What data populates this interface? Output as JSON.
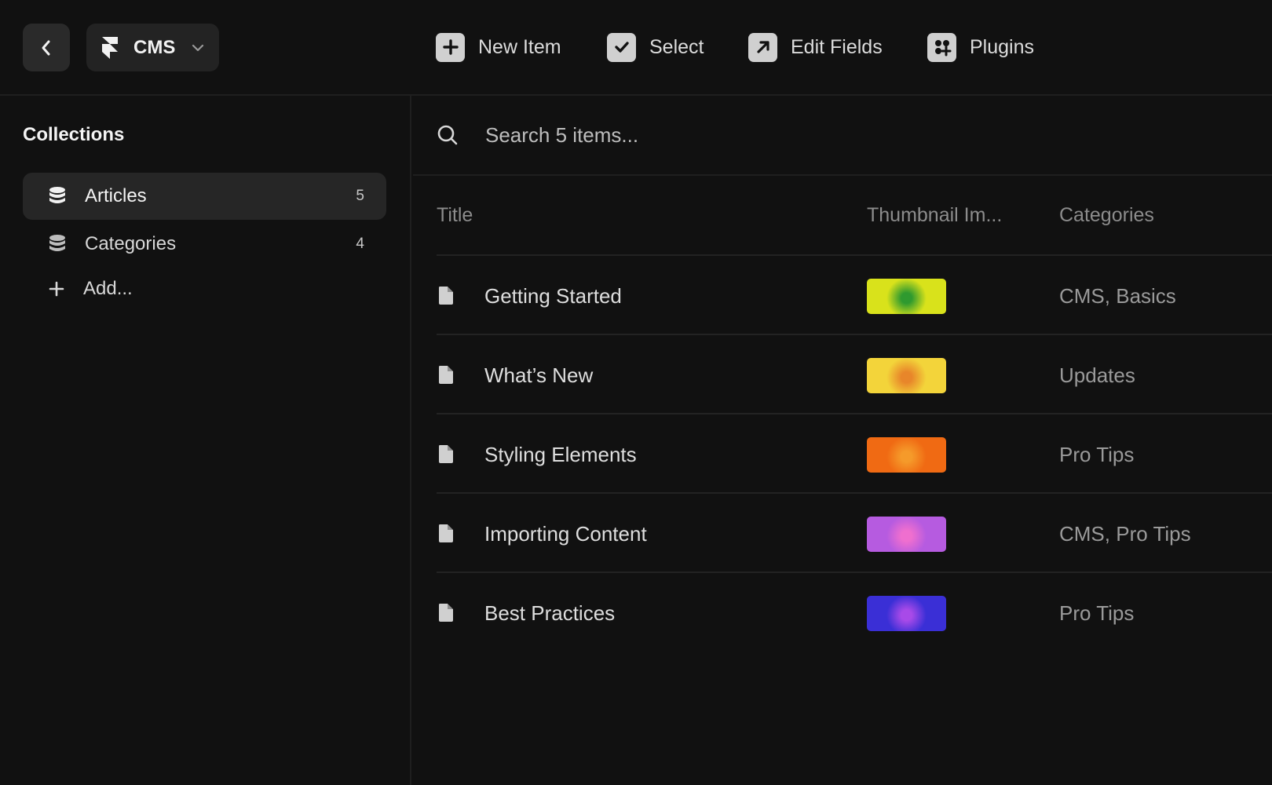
{
  "toolbar": {
    "back_icon": "chevron-left-icon",
    "cms_label": "CMS",
    "new_item": "New Item",
    "select": "Select",
    "edit_fields": "Edit Fields",
    "plugins": "Plugins"
  },
  "sidebar": {
    "title": "Collections",
    "items": [
      {
        "label": "Articles",
        "count": "5",
        "icon": "database-icon",
        "active": true
      },
      {
        "label": "Categories",
        "count": "4",
        "icon": "database-icon",
        "active": false
      }
    ],
    "add_label": "Add..."
  },
  "search": {
    "placeholder": "Search 5 items..."
  },
  "table": {
    "headers": {
      "title": "Title",
      "thumbnail": "Thumbnail Im...",
      "categories": "Categories"
    },
    "rows": [
      {
        "title": "Getting Started",
        "categories": "CMS, Basics",
        "thumb_colors": [
          "#d9e21b",
          "#2f9a2f"
        ]
      },
      {
        "title": "What’s New",
        "categories": "Updates",
        "thumb_colors": [
          "#f3d43a",
          "#e8862a"
        ]
      },
      {
        "title": "Styling Elements",
        "categories": "Pro Tips",
        "thumb_colors": [
          "#f06a13",
          "#f59a2a"
        ]
      },
      {
        "title": "Importing Content",
        "categories": "CMS, Pro Tips",
        "thumb_colors": [
          "#b65be0",
          "#ef6fcf"
        ]
      },
      {
        "title": "Best Practices",
        "categories": "Pro Tips",
        "thumb_colors": [
          "#3a2fd6",
          "#a84ae8"
        ]
      }
    ]
  },
  "colors": {
    "background": "#111111",
    "active_item": "#262626",
    "icon_fill": "#d0d0d0"
  }
}
